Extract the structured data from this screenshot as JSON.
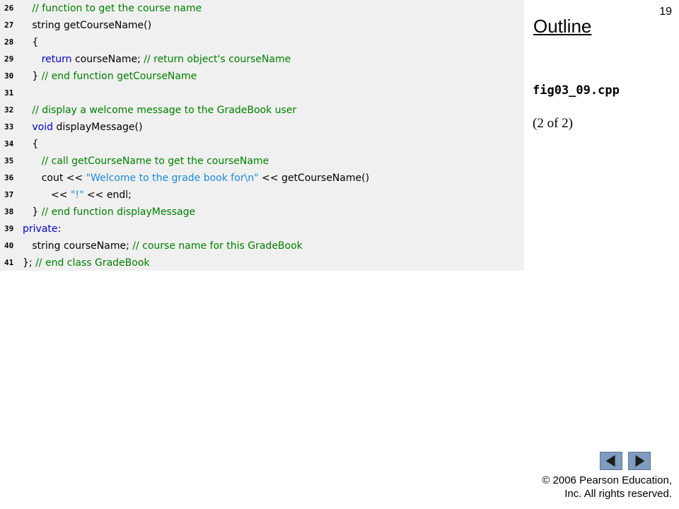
{
  "slide_number": "19",
  "sidebar": {
    "title": "Outline",
    "file_name": "fig03_09.cpp",
    "page_indicator": "(2 of 2)"
  },
  "code_lines": [
    {
      "num": "26",
      "segments": [
        {
          "t": "   ",
          "c": "tx"
        },
        {
          "t": "// function to get the course name",
          "c": "cm"
        }
      ]
    },
    {
      "num": "27",
      "segments": [
        {
          "t": "   string getCourseName()",
          "c": "tx"
        }
      ]
    },
    {
      "num": "28",
      "segments": [
        {
          "t": "   {",
          "c": "tx"
        }
      ]
    },
    {
      "num": "29",
      "segments": [
        {
          "t": "      ",
          "c": "tx"
        },
        {
          "t": "return",
          "c": "kw"
        },
        {
          "t": " courseName; ",
          "c": "tx"
        },
        {
          "t": "// return object's courseName",
          "c": "cm"
        }
      ]
    },
    {
      "num": "30",
      "segments": [
        {
          "t": "   } ",
          "c": "tx"
        },
        {
          "t": "// end function getCourseName",
          "c": "cm"
        }
      ]
    },
    {
      "num": "31",
      "segments": []
    },
    {
      "num": "32",
      "segments": [
        {
          "t": "   ",
          "c": "tx"
        },
        {
          "t": "// display a welcome message to the GradeBook user",
          "c": "cm"
        }
      ]
    },
    {
      "num": "33",
      "segments": [
        {
          "t": "   ",
          "c": "tx"
        },
        {
          "t": "void",
          "c": "kw"
        },
        {
          "t": " displayMessage()",
          "c": "tx"
        }
      ]
    },
    {
      "num": "34",
      "segments": [
        {
          "t": "   {",
          "c": "tx"
        }
      ]
    },
    {
      "num": "35",
      "segments": [
        {
          "t": "      ",
          "c": "tx"
        },
        {
          "t": "// call getCourseName to get the courseName",
          "c": "cm"
        }
      ]
    },
    {
      "num": "36",
      "segments": [
        {
          "t": "      cout << ",
          "c": "tx"
        },
        {
          "t": "\"Welcome to the grade book for\\n\"",
          "c": "str"
        },
        {
          "t": " << getCourseName()",
          "c": "tx"
        }
      ]
    },
    {
      "num": "37",
      "segments": [
        {
          "t": "         << ",
          "c": "tx"
        },
        {
          "t": "\"!\"",
          "c": "str"
        },
        {
          "t": " << endl;",
          "c": "tx"
        }
      ]
    },
    {
      "num": "38",
      "segments": [
        {
          "t": "   } ",
          "c": "tx"
        },
        {
          "t": "// end function displayMessage",
          "c": "cm"
        }
      ]
    },
    {
      "num": "39",
      "segments": [
        {
          "t": "private",
          "c": "kw"
        },
        {
          "t": ":",
          "c": "tx"
        }
      ]
    },
    {
      "num": "40",
      "segments": [
        {
          "t": "   string courseName; ",
          "c": "tx"
        },
        {
          "t": "// course name for this GradeBook",
          "c": "cm"
        }
      ]
    },
    {
      "num": "41",
      "segments": [
        {
          "t": "}; ",
          "c": "tx"
        },
        {
          "t": "// end class GradeBook",
          "c": "cm"
        }
      ]
    }
  ],
  "navigation": {
    "prev_icon": "triangle-left-icon",
    "next_icon": "triangle-right-icon"
  },
  "copyright": {
    "line1": "© 2006 Pearson Education,",
    "line2": "Inc.  All rights reserved."
  },
  "colors": {
    "code_background": "#f0f0f0",
    "comment": "#008000",
    "keyword": "#0000cc",
    "string": "#1a8cd8",
    "nav_button": "#7f9bbd"
  }
}
